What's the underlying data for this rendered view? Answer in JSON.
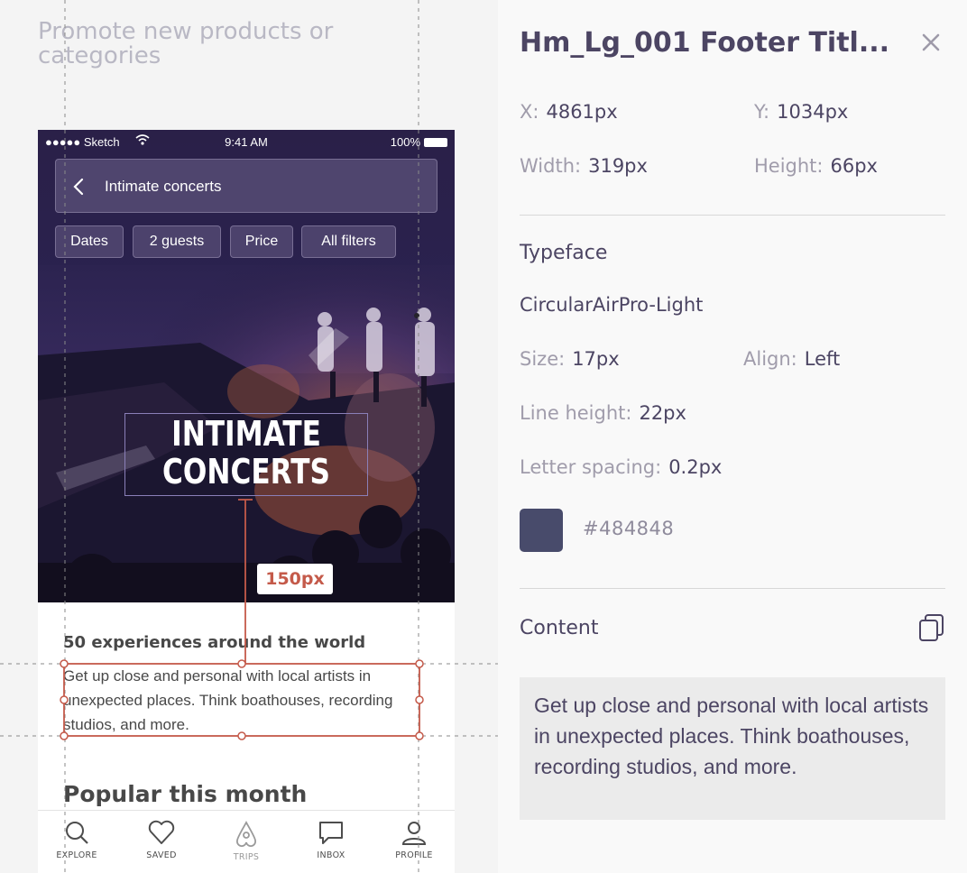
{
  "canvas": {
    "artboard_title": "Promote new products or categories",
    "phone": {
      "status_bar": {
        "signal": "●●●●● Sketch",
        "time": "9:41 AM",
        "battery": "100%"
      },
      "search": {
        "text": "Intimate concerts"
      },
      "filters": [
        "Dates",
        "2 guests",
        "Price",
        "All filters"
      ],
      "hero_title_line1": "INTIMATE",
      "hero_title_line2": "CONCERTS",
      "section_heading": "50 experiences around the world",
      "section_desc": "Get up close and personal with local artists in unexpected places. Think boathouses, recording studios, and more.",
      "popular_heading": "Popular this month",
      "tabs": [
        {
          "label": "EXPLORE",
          "icon": "search-icon"
        },
        {
          "label": "SAVED",
          "icon": "heart-icon"
        },
        {
          "label": "TRIPS",
          "icon": "airbnb-logo-icon"
        },
        {
          "label": "INBOX",
          "icon": "chat-icon"
        },
        {
          "label": "PROFILE",
          "icon": "profile-icon"
        }
      ]
    },
    "measure_label": "150px"
  },
  "inspector": {
    "layer_name": "Hm_Lg_001 Footer Titl...",
    "close_icon": "close-icon",
    "position": {
      "x_label": "X:",
      "x_value": "4861px",
      "y_label": "Y:",
      "y_value": "1034px"
    },
    "size": {
      "width_label": "Width:",
      "width_value": "319px",
      "height_label": "Height:",
      "height_value": "66px"
    },
    "typeface": {
      "section_title": "Typeface",
      "font_name": "CircularAirPro-Light",
      "size_label": "Size:",
      "size_value": "17px",
      "align_label": "Align:",
      "align_value": "Left",
      "line_height_label": "Line height:",
      "line_height_value": "22px",
      "letter_spacing_label": "Letter spacing:",
      "letter_spacing_value": "0.2px",
      "color_hex": "#484848"
    },
    "content": {
      "section_title": "Content",
      "copy_icon": "copy-icon",
      "text": "Get up close and personal with local artists in unexpected places. Think boathouses, recording studios, and more."
    }
  },
  "colors": {
    "accent_measure": "#c45a4a",
    "text_dark": "#4c4563",
    "swatch": "#484b6b"
  }
}
